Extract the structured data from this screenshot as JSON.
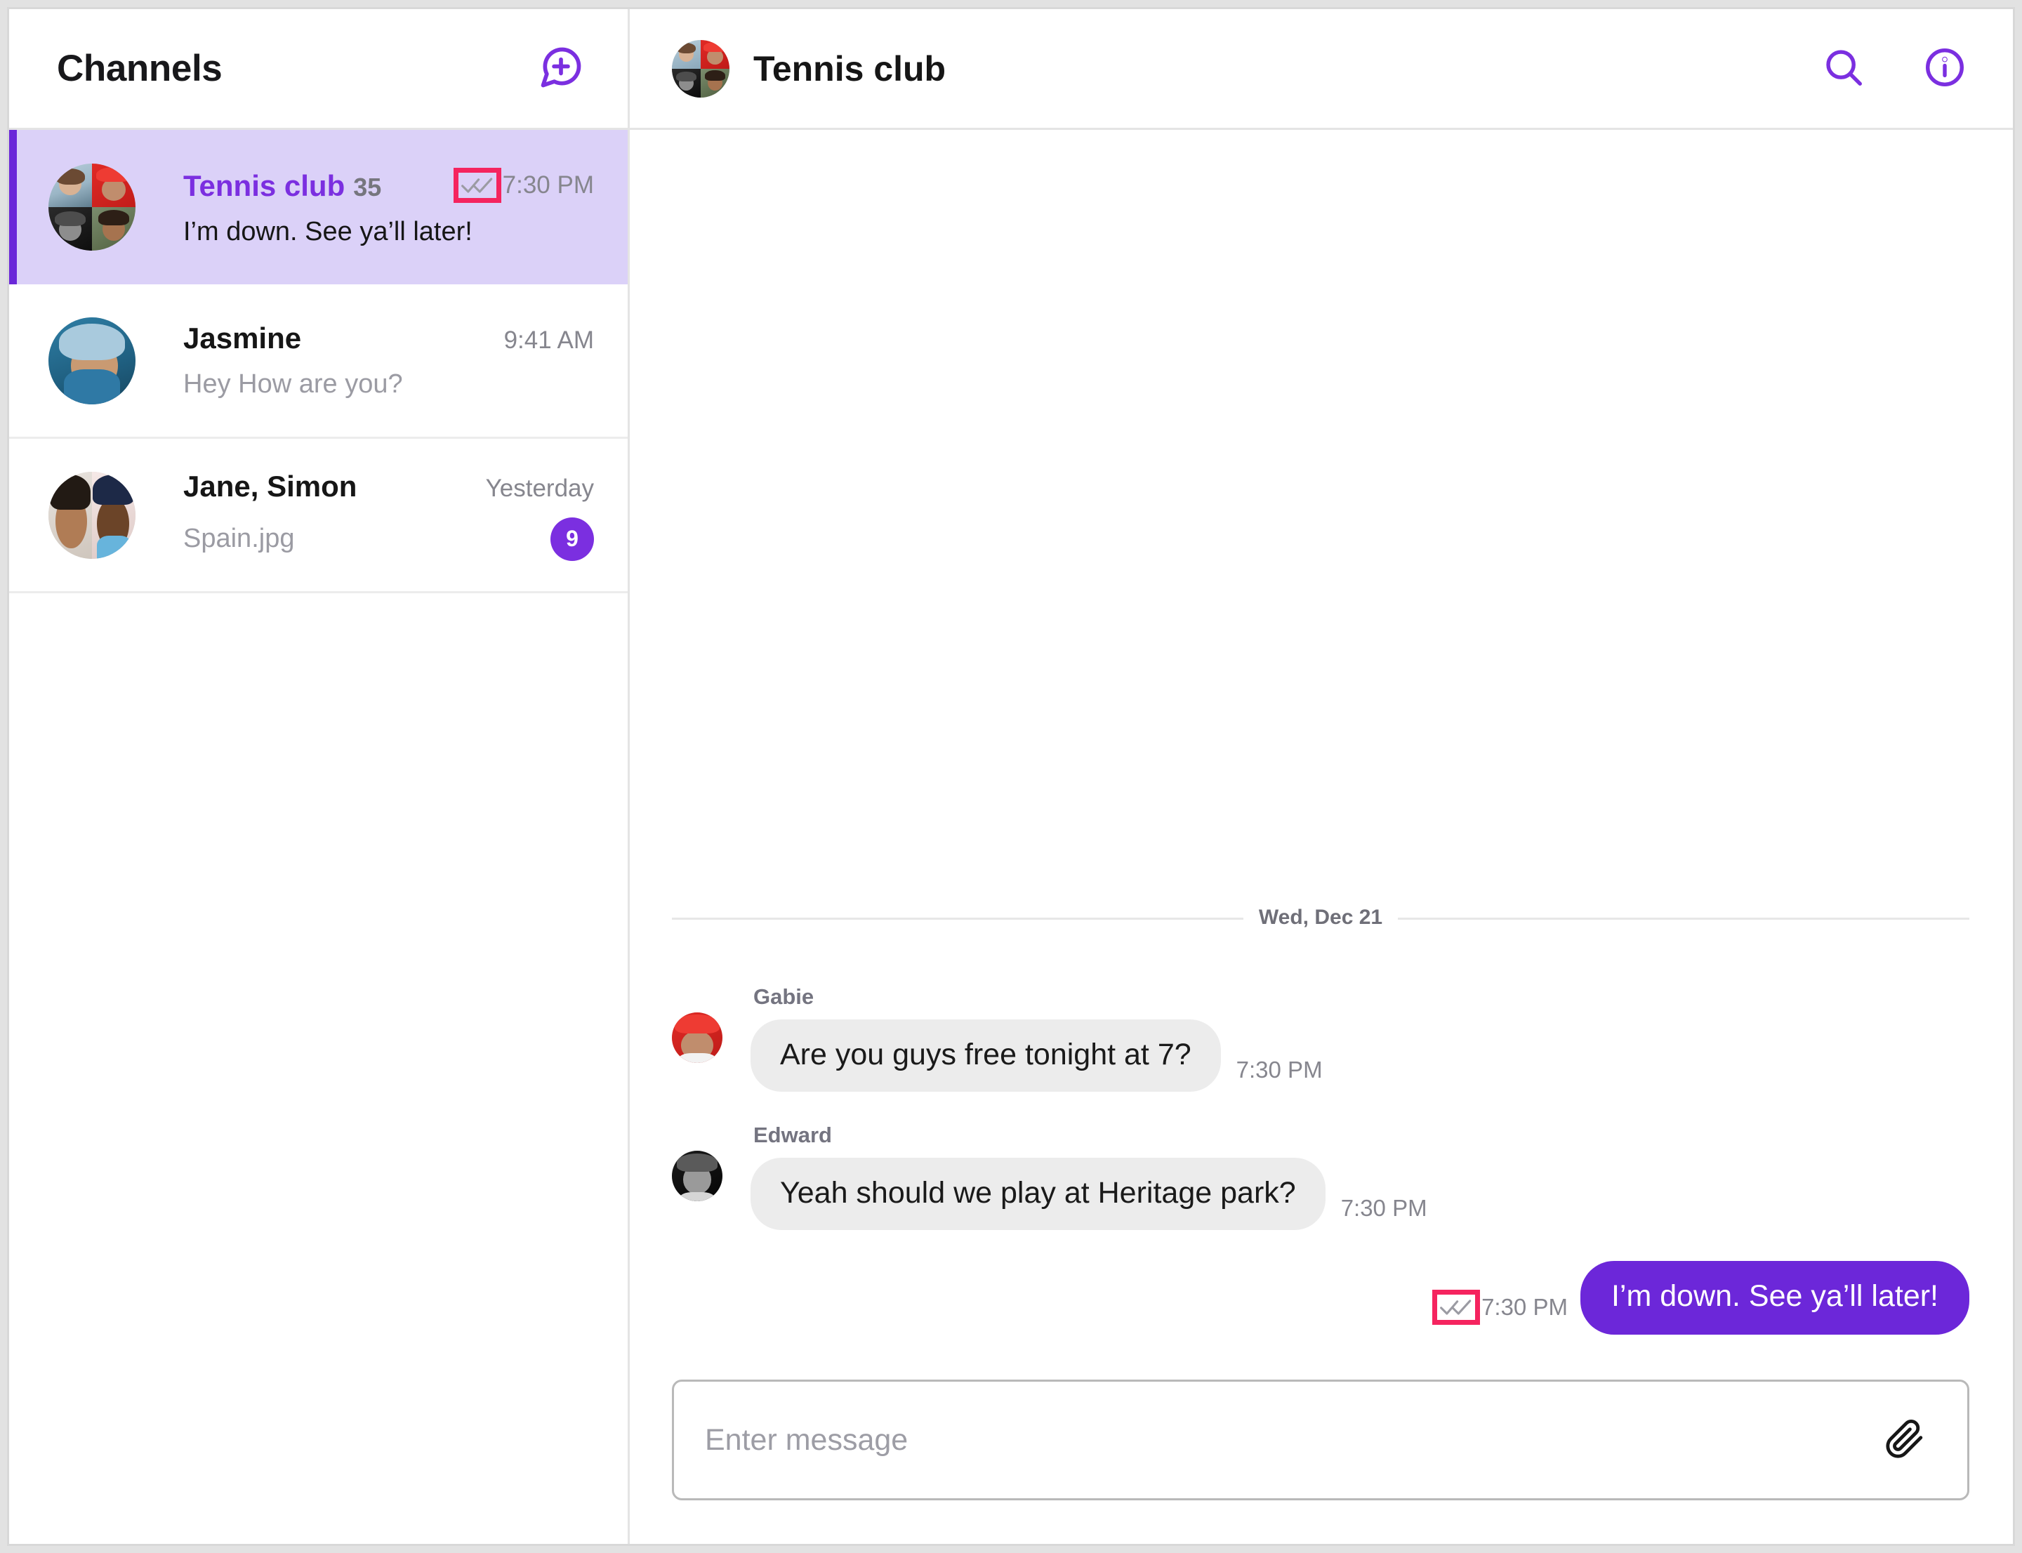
{
  "sidebar": {
    "title": "Channels",
    "new_chat_icon": "new-chat-bubble-plus-icon",
    "channels": [
      {
        "name": "Tennis club",
        "count": "35",
        "time": "7:30 PM",
        "preview": "I’m down. See ya’ll later!",
        "read_ticks": "double-check-icon",
        "ticks_highlighted": true,
        "selected": true,
        "badge": ""
      },
      {
        "name": "Jasmine",
        "count": "",
        "time": "9:41 AM",
        "preview": "Hey How are you?",
        "read_ticks": "",
        "ticks_highlighted": false,
        "selected": false,
        "badge": ""
      },
      {
        "name": "Jane, Simon",
        "count": "",
        "time": "Yesterday",
        "preview": "Spain.jpg",
        "read_ticks": "",
        "ticks_highlighted": false,
        "selected": false,
        "badge": "9"
      }
    ]
  },
  "chat": {
    "title": "Tennis club",
    "search_icon": "search-icon",
    "info_icon": "info-circle-icon",
    "date_separator": "Wed, Dec 21",
    "messages": [
      {
        "sender": "Gabie",
        "text": "Are you guys free tonight at 7?",
        "time": "7:30 PM",
        "direction": "in"
      },
      {
        "sender": "Edward",
        "text": "Yeah should we play at Heritage park?",
        "time": "7:30 PM",
        "direction": "in"
      },
      {
        "sender": "",
        "text": "I’m down. See ya’ll later!",
        "time": "7:30 PM",
        "direction": "out",
        "read_ticks": "double-check-icon",
        "ticks_highlighted": true
      }
    ],
    "composer": {
      "placeholder": "Enter message",
      "value": "",
      "attach_icon": "paperclip-icon"
    }
  },
  "colors": {
    "accent_purple": "#6c27d9",
    "accent_purple_light": "#7b2fe0",
    "selected_row_bg": "#dbd1f8",
    "highlight_pink": "#f5245f",
    "bubble_in_bg": "#ececec",
    "muted_text": "#86868e"
  }
}
